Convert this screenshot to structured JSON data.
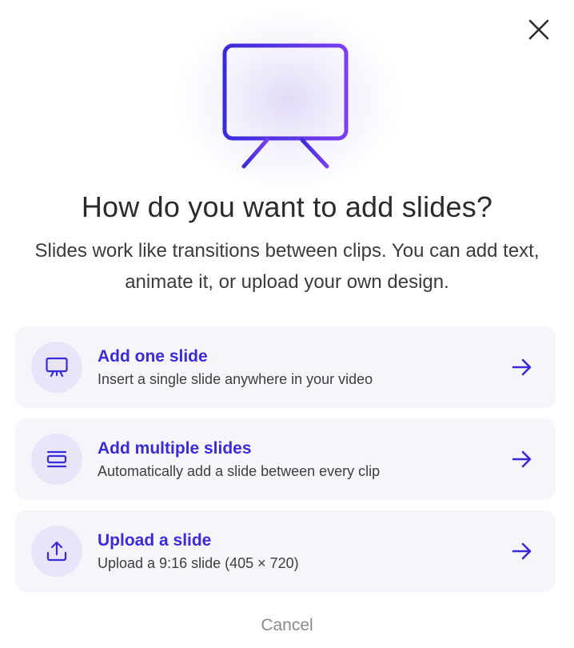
{
  "dialog": {
    "title": "How do you want to add slides?",
    "subtitle": "Slides work like transitions between clips. You can add text, animate it, or upload your own design.",
    "close_icon": "close-icon",
    "hero_icon": "presentation-board-icon"
  },
  "options": [
    {
      "title": "Add one slide",
      "description": "Insert a single slide anywhere in your video",
      "icon": "presentation-icon"
    },
    {
      "title": "Add multiple slides",
      "description": "Automatically add a slide between every clip",
      "icon": "stack-icon"
    },
    {
      "title": "Upload a slide",
      "description": "Upload a 9:16 slide (405 × 720)",
      "icon": "upload-icon"
    }
  ],
  "cancel_label": "Cancel",
  "colors": {
    "accent": "#3a2bd8",
    "accent_gradient_end": "#7a3ff0",
    "card_background": "#f6f5fc",
    "icon_circle": "#e8e5f8"
  }
}
